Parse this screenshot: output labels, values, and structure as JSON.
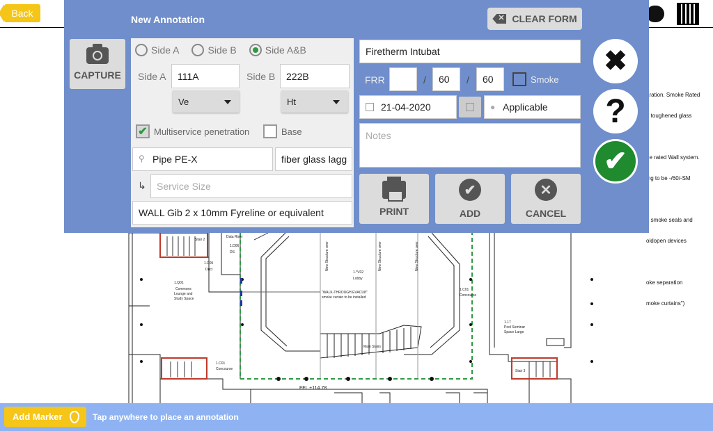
{
  "topbar": {
    "back_label": "Back"
  },
  "drawing_notes": {
    "lines": [
      "aration. Smoke Rated",
      "e toughened glass",
      "",
      "ire rated Wall system.",
      "ing to be -/60/-SM",
      "",
      "n smoke seals and",
      "oldopen devices",
      "",
      "oke separation",
      "moke curtains\")"
    ]
  },
  "drawing_labels": {
    "data_riser": "Data Riser",
    "stair2": "Stair 2",
    "d06": "1.D06",
    "ds": "DS",
    "d05": "1.D05",
    "duct": "Duct",
    "q01": "1.Q01",
    "commons": "Commons",
    "lounge": "Lounge and",
    "study": "Study Space",
    "v02": "1.*V02",
    "lobby": "Lobby",
    "walk": "\"WALK-THROUGH EVACU8\"",
    "curtain": "smoke curtain to be installed",
    "c01_top": "1.C01",
    "concourse_top": "Concourse",
    "main_stairs": "Main Stairs",
    "s17": "1.17",
    "pool": "Pool Seminar",
    "space_large": "Space Large",
    "c01_bottom": "1.C01",
    "concourse_bottom": "Concourse",
    "ffl": "FFL +114.78",
    "stair3": "Stair 3",
    "new_structure": "New Structure over"
  },
  "panel": {
    "title": "New Annotation",
    "clear_label": "CLEAR FORM",
    "capture_label": "CAPTURE",
    "radios": [
      {
        "label": "Side A",
        "selected": false
      },
      {
        "label": "Side B",
        "selected": false
      },
      {
        "label": "Side A&B",
        "selected": true
      }
    ],
    "side_a_label": "Side A",
    "side_a_value": "111A",
    "side_b_label": "Side B",
    "side_b_value": "222B",
    "side_a_select": "Ve",
    "side_b_select": "Ht",
    "multiservice_label": "Multiservice penetration",
    "multiservice_checked": true,
    "base_label": "Base",
    "base_checked": false,
    "service_value": "Pipe PE-X",
    "lagging_value": "fiber glass lagg",
    "service_size_placeholder": "Service Size",
    "wall_value": "WALL Gib 2 x 10mm Fyreline or equivalent",
    "product_value": "Firetherm Intubat",
    "frr_label": "FRR",
    "frr_1": "",
    "frr_2": "60",
    "frr_3": "60",
    "slash": "/",
    "smoke_label": "Smoke",
    "date_value": "21-04-2020",
    "applicable_value": "Applicable",
    "notes_placeholder": "Notes",
    "print_label": "PRINT",
    "add_label": "ADD",
    "cancel_label": "CANCEL"
  },
  "side_buttons": {
    "close_glyph": "✖",
    "help_glyph": "?",
    "ok_glyph": "✔",
    "ok_color": "#1f8a2e"
  },
  "bottombar": {
    "add_marker_label": "Add Marker",
    "hint": "Tap anywhere to place an annotation"
  }
}
